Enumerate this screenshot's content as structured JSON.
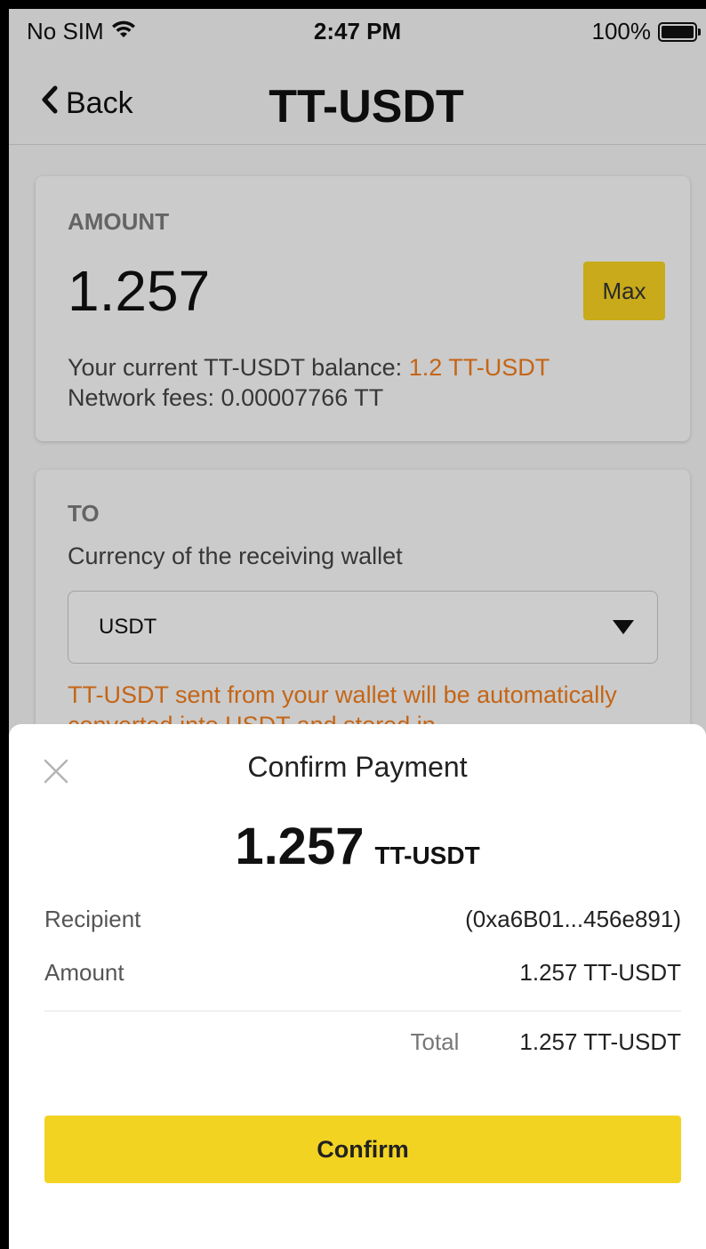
{
  "status_bar": {
    "carrier": "No SIM",
    "time": "2:47 PM",
    "battery": "100%",
    "icons": [
      "wifi-icon",
      "battery-icon"
    ]
  },
  "nav": {
    "back_label": "Back",
    "title": "TT-USDT",
    "back_icon": "chevron-left-icon"
  },
  "amount_card": {
    "label": "AMOUNT",
    "amount": "1.257",
    "max_label": "Max",
    "balance_prefix": "Your current TT-USDT balance: ",
    "balance_value": "1.2 TT-USDT",
    "fees": "Network fees: 0.00007766 TT"
  },
  "to_card": {
    "label": "TO",
    "currency_label": "Currency of the receiving wallet",
    "currency_selected": "USDT",
    "note": "TT-USDT sent from your wallet will be automatically converted into USDT and stored in"
  },
  "confirm_sheet": {
    "title": "Confirm Payment",
    "amount": "1.257",
    "unit": "TT-USDT",
    "recipient_label": "Recipient",
    "recipient_value": "(0xa6B01...456e891)",
    "amount_label": "Amount",
    "amount_value": "1.257 TT-USDT",
    "total_label": "Total",
    "total_value": "1.257 TT-USDT",
    "confirm_label": "Confirm"
  },
  "colors": {
    "accent_yellow": "#f3d322",
    "warning_orange": "#f07c1c",
    "text_dark": "#111111"
  }
}
